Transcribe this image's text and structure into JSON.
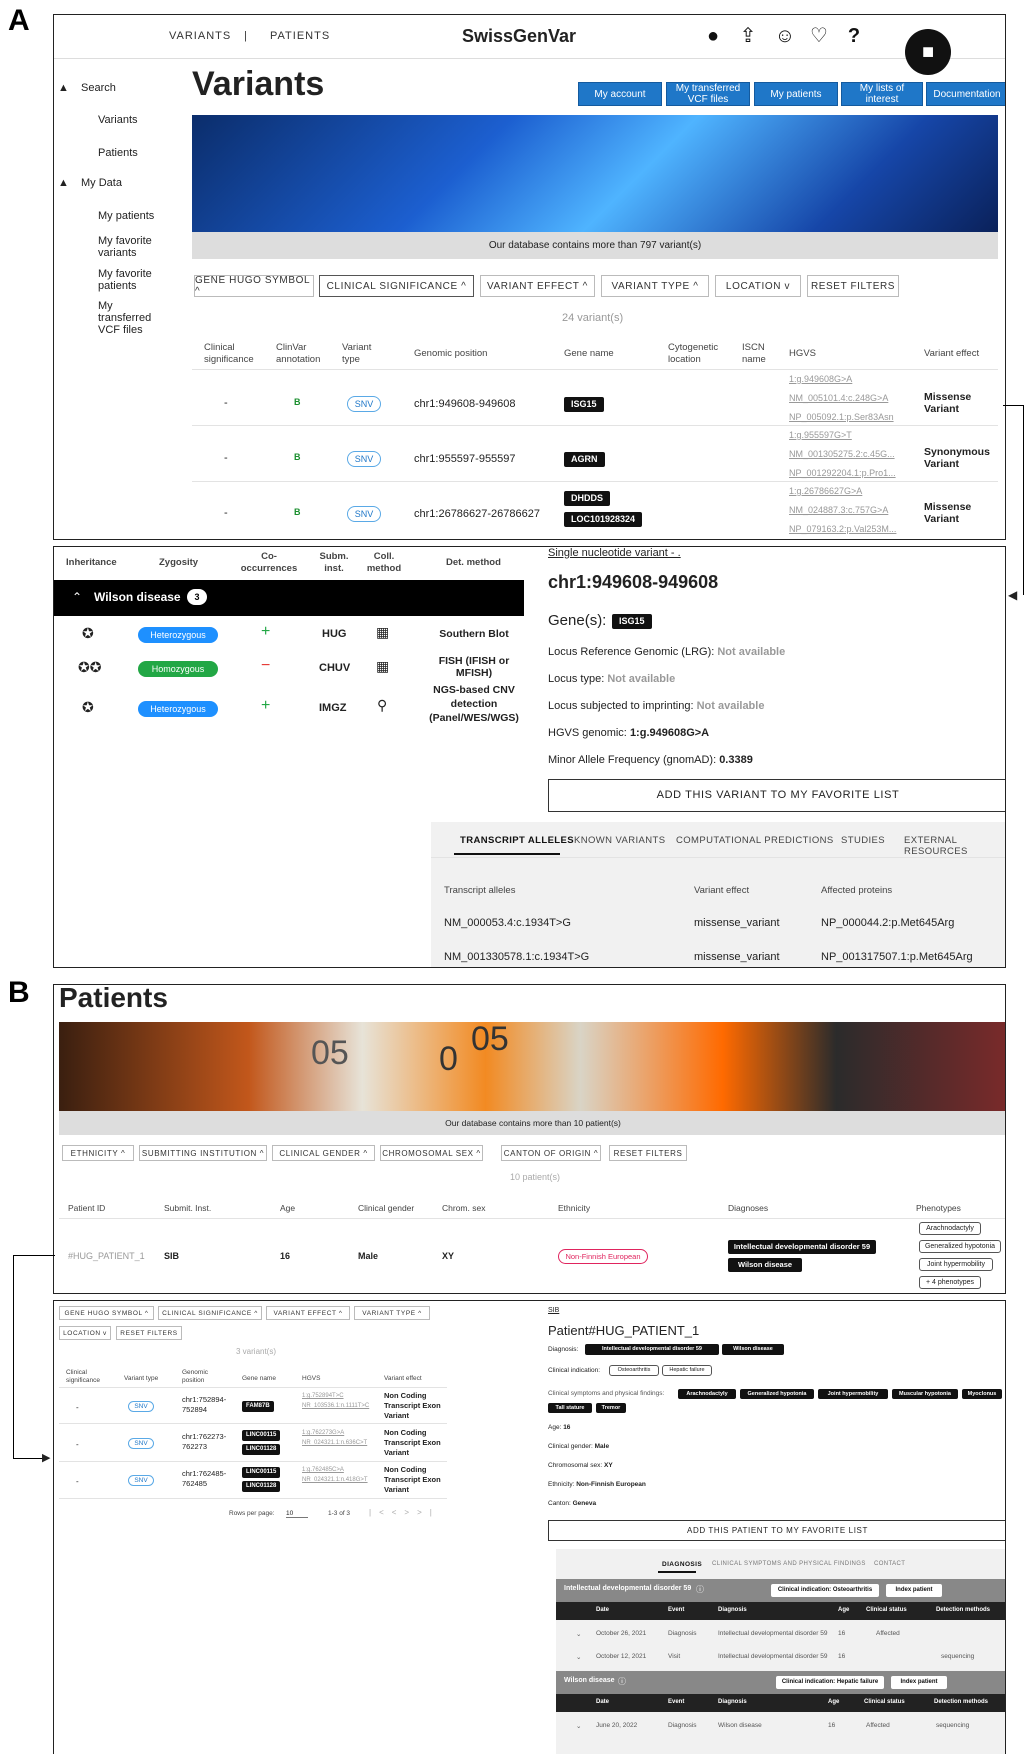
{
  "labels": {
    "a": "A",
    "b": "B"
  },
  "nav": {
    "variants": "VARIANTS",
    "separator": "|",
    "patients": "PATIENTS",
    "brand": "SwissGenVar",
    "help": "?"
  },
  "sidebar": {
    "search": "Search",
    "variants": "Variants",
    "patients": "Patients",
    "my_data": "My Data",
    "my_patients": "My patients",
    "fav_variants": "My favorite variants",
    "fav_patients": "My favorite patients",
    "vcf": "My transferred VCF files"
  },
  "variants_page": {
    "title": "Variants",
    "buttons": [
      "My account",
      "My transferred VCF files",
      "My patients",
      "My lists of interest",
      "Documentation"
    ],
    "db_count": "Our database contains more than 797 variant(s)",
    "filters": [
      "GENE HUGO SYMBOL ^",
      "CLINICAL SIGNIFICANCE ^",
      "VARIANT EFFECT ^",
      "VARIANT TYPE ^",
      "LOCATION v",
      "RESET FILTERS"
    ],
    "count": "24 variant(s)",
    "columns": [
      "Clinical significance",
      "ClinVar annotation",
      "Variant type",
      "Genomic position",
      "Gene name",
      "Cytogenetic location",
      "ISCN name",
      "HGVS",
      "Variant effect"
    ],
    "rows": [
      {
        "sig": "-",
        "clinvar": "B",
        "type": "SNV",
        "pos": "chr1:949608-949608",
        "genes": [
          "ISG15"
        ],
        "hgvs": [
          "1:g.949608G>A",
          "NM_005101.4:c.248G>A",
          "NP_005092.1:p.Ser83Asn"
        ],
        "effect": "Missense Variant"
      },
      {
        "sig": "-",
        "clinvar": "B",
        "type": "SNV",
        "pos": "chr1:955597-955597",
        "genes": [
          "AGRN"
        ],
        "hgvs": [
          "1:g.955597G>T",
          "NM_001305275.2:c.45G...",
          "NP_001292204.1:p.Pro1..."
        ],
        "effect": "Synonymous Variant"
      },
      {
        "sig": "-",
        "clinvar": "B",
        "type": "SNV",
        "pos": "chr1:26786627-26786627",
        "genes": [
          "DHDDS",
          "LOC101928324"
        ],
        "hgvs": [
          "1:g.26786627G>A",
          "NM_024887.3:c.757G>A",
          "NP_079163.2:p.Val253M..."
        ],
        "effect": "Missense Variant"
      }
    ]
  },
  "variant_detail": {
    "cols": [
      "Inheritance",
      "Zygosity",
      "Co-occurrences",
      "Subm. inst.",
      "Coll. method",
      "Det. method"
    ],
    "disease": "Wilson disease",
    "disease_count": "3",
    "rows": [
      {
        "zyg": "Heterozygous",
        "co": "+",
        "inst": "HUG",
        "method": "Southern Blot"
      },
      {
        "zyg": "Homozygous",
        "co": "−",
        "inst": "CHUV",
        "method": "FISH (IFISH or MFISH)"
      },
      {
        "zyg": "Heterozygous",
        "co": "+",
        "inst": "IMGZ",
        "method": "NGS-based CNV detection (Panel/WES/WGS)"
      }
    ],
    "kind": "Single nucleotide variant - .",
    "title": "chr1:949608-949608",
    "genes_label": "Gene(s):",
    "gene": "ISG15",
    "lrg_label": "Locus Reference Genomic (LRG):",
    "lrg_value": "Not available",
    "locus_type_label": "Locus type:",
    "locus_type_value": "Not available",
    "imprint_label": "Locus subjected to imprinting:",
    "imprint_value": "Not available",
    "hgvs_label": "HGVS genomic:",
    "hgvs_value": "1:g.949608G>A",
    "maf_label": "Minor Allele Frequency (gnomAD):",
    "maf_value": "0.3389",
    "fav_button": "ADD THIS VARIANT TO MY FAVORITE LIST",
    "tabs": [
      "TRANSCRIPT ALLELES",
      "KNOWN VARIANTS",
      "COMPUTATIONAL PREDICTIONS",
      "STUDIES",
      "EXTERNAL RESOURCES"
    ],
    "table_cols": [
      "Transcript alleles",
      "Variant effect",
      "Affected proteins"
    ],
    "table_rows": [
      [
        "NM_000053.4:c.1934T>G",
        "missense_variant",
        "NP_000044.2:p.Met645Arg"
      ],
      [
        "NM_001330578.1:c.1934T>G",
        "missense_variant",
        "NP_001317507.1:p.Met645Arg"
      ]
    ]
  },
  "patients_page": {
    "title": "Patients",
    "banner_text": [
      "05",
      "0",
      "05"
    ],
    "db_count": "Our database contains more than 10 patient(s)",
    "filters": [
      "ETHNICITY ^",
      "SUBMITTING INSTITUTION ^",
      "CLINICAL GENDER ^",
      "CHROMOSOMAL SEX ^",
      "CANTON OF ORIGIN ^",
      "RESET FILTERS"
    ],
    "count": "10 patient(s)",
    "columns": [
      "Patient ID",
      "Submit. Inst.",
      "Age",
      "Clinical gender",
      "Chrom. sex",
      "Ethnicity",
      "Diagnoses",
      "Phenotypes"
    ],
    "row": {
      "id": "#HUG_PATIENT_1",
      "inst": "SIB",
      "age": "16",
      "gender": "Male",
      "sex": "XY",
      "ethnicity": "Non-Finnish European",
      "diagnoses": [
        "Intellectual developmental disorder 59",
        "Wilson disease"
      ],
      "phenotypes": [
        "Arachnodactyly",
        "Generalized hypotonia",
        "Joint hypermobility",
        "+ 4 phenotypes"
      ]
    }
  },
  "patient_variants": {
    "filters": [
      "GENE HUGO SYMBOL ^",
      "CLINICAL SIGNIFICANCE ^",
      "VARIANT EFFECT ^",
      "VARIANT TYPE ^",
      "LOCATION v",
      "RESET FILTERS"
    ],
    "count": "3 variant(s)",
    "columns": [
      "Clinical significance",
      "Variant type",
      "Genomic position",
      "Gene name",
      "HGVS",
      "Variant effect"
    ],
    "rows": [
      {
        "sig": "-",
        "type": "SNV",
        "pos": "chr1:752894-752894",
        "genes": [
          "FAM87B"
        ],
        "hgvs": [
          "1:g.752894T>C",
          "NR_103536.1:n.1111T>C"
        ],
        "effect": "Non Coding Transcript Exon Variant"
      },
      {
        "sig": "-",
        "type": "SNV",
        "pos": "chr1:762273-762273",
        "genes": [
          "LINC00115",
          "LINC01128"
        ],
        "hgvs": [
          "1:g.762273G>A",
          "NR_024321.1:n.636C>T"
        ],
        "effect": "Non Coding Transcript Exon Variant"
      },
      {
        "sig": "-",
        "type": "SNV",
        "pos": "chr1:762485-762485",
        "genes": [
          "LINC00115",
          "LINC01128"
        ],
        "hgvs": [
          "1:g.762485C>A",
          "NR_024321.1:n.418G>T"
        ],
        "effect": "Non Coding Transcript Exon Variant"
      }
    ],
    "rows_per_page_label": "Rows per page:",
    "rows_per_page": "10",
    "range": "1-3 of 3"
  },
  "patient_detail": {
    "inst": "SIB",
    "title": "Patient#HUG_PATIENT_1",
    "diagnosis_label": "Diagnosis:",
    "diagnoses": [
      "Intellectual developmental disorder 59",
      "Wilson disease"
    ],
    "indication_label": "Clinical indication:",
    "indications": [
      "Osteoarthritis",
      "Hepatic failure"
    ],
    "symptoms_label": "Clinical symptoms and physical findings:",
    "symptoms": [
      "Arachnodactyly",
      "Generalized hypotonia",
      "Joint hypermobility",
      "Muscular hypotonia",
      "Myoclonus",
      "Tall stature",
      "Tremor"
    ],
    "age_label": "Age:",
    "age": "16",
    "gender_label": "Clinical gender:",
    "gender": "Male",
    "sex_label": "Chromosomal sex:",
    "sex": "XY",
    "ethnicity_label": "Ethnicity:",
    "ethnicity": "Non-Finnish European",
    "canton_label": "Canton:",
    "canton": "Geneva",
    "fav_button": "ADD THIS PATIENT TO MY FAVORITE LIST",
    "tabs": [
      "DIAGNOSIS",
      "CLINICAL SYMPTOMS AND PHYSICAL FINDINGS",
      "CONTACT"
    ],
    "groups": [
      {
        "name": "Intellectual developmental disorder 59",
        "indication": "Clinical indication: Osteoarthritis",
        "index": "Index patient",
        "cols": [
          "Date",
          "Event",
          "Diagnosis",
          "Age",
          "Clinical status",
          "Detection methods"
        ],
        "rows": [
          [
            "October 26, 2021",
            "Diagnosis",
            "Intellectual developmental disorder 59",
            "16",
            "Affected",
            ""
          ],
          [
            "October 12, 2021",
            "Visit",
            "Intellectual developmental disorder 59",
            "16",
            "",
            "sequencing"
          ]
        ]
      },
      {
        "name": "Wilson disease",
        "indication": "Clinical indication: Hepatic failure",
        "index": "Index patient",
        "cols": [
          "Date",
          "Event",
          "Diagnosis",
          "Age",
          "Clinical status",
          "Detection methods"
        ],
        "rows": [
          [
            "June 20, 2022",
            "Diagnosis",
            "Wilson disease",
            "16",
            "Affected",
            "sequencing"
          ]
        ]
      }
    ]
  },
  "colors": {
    "accent_blue": "#1f77c8",
    "heterozygous": "#1e90ff",
    "homozygous": "#22a745",
    "plus": "#22a745",
    "minus": "#e53935",
    "ethnicity_pill": "#e0245e"
  }
}
